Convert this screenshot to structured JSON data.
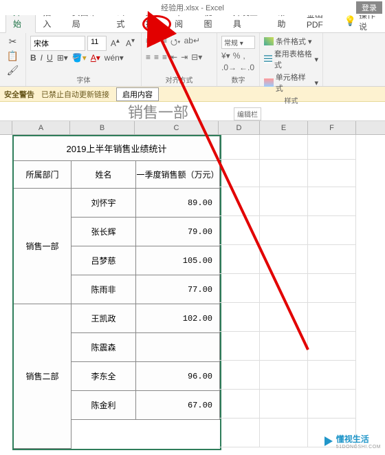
{
  "title": {
    "filename": "经验用.xlsx",
    "app": "Excel",
    "login": "登录"
  },
  "tabs": [
    "开始",
    "插入",
    "页面布局",
    "公式",
    "数据",
    "审阅",
    "视图",
    "开发工具",
    "帮助",
    "金山PDF"
  ],
  "active_tab": 0,
  "help_text": "操作说",
  "ribbon": {
    "font_name": "宋体",
    "font_size": "11",
    "inc_a": "A↑",
    "dec_a": "A↓",
    "group_font": "字体",
    "group_align": "对齐方式",
    "group_num": "数字",
    "group_style": "样式",
    "num_general": "常规",
    "style1": "条件格式",
    "style2": "套用表格格式",
    "style3": "单元格样式"
  },
  "warning": {
    "label": "安全警告",
    "msg": "已禁止自动更新链接",
    "btn": "启用内容"
  },
  "formula": {
    "cell_content": "销售一部",
    "hint": "编辑栏"
  },
  "columns": [
    "A",
    "B",
    "C",
    "D",
    "E",
    "F"
  ],
  "sheet": {
    "title": "2019上半年销售业绩统计",
    "headers": [
      "所属部门",
      "姓名",
      "一季度销售额（万元）"
    ],
    "groups": [
      {
        "dept": "销售一部",
        "rows": [
          {
            "name": "刘怀宇",
            "val": "89.00"
          },
          {
            "name": "张长辉",
            "val": "79.00"
          },
          {
            "name": "吕梦慈",
            "val": "105.00"
          },
          {
            "name": "陈雨非",
            "val": "77.00"
          }
        ]
      },
      {
        "dept": "销售二部",
        "rows": [
          {
            "name": "王凯政",
            "val": "102.00"
          },
          {
            "name": "陈震森",
            "val": ""
          },
          {
            "name": "李东全",
            "val": "96.00"
          },
          {
            "name": "陈金利",
            "val": "67.00"
          }
        ]
      }
    ]
  },
  "watermark": {
    "text": "懂视生活",
    "sub": "51DONGSHI.COM"
  }
}
